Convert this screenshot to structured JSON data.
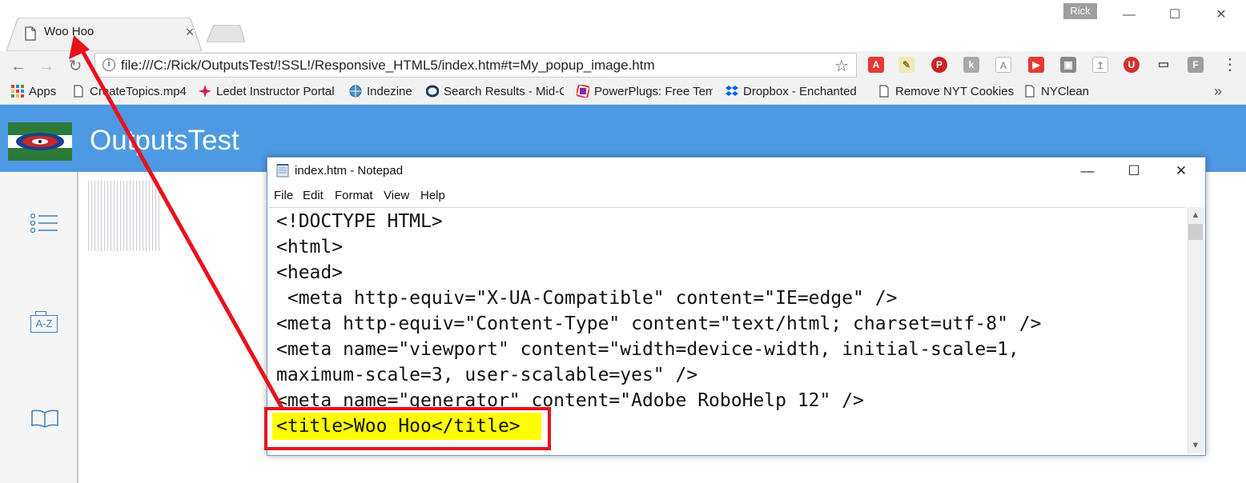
{
  "browser": {
    "tab": {
      "title": "Woo Hoo",
      "close": "×"
    },
    "user": "Rick",
    "window_controls": {
      "minimize": "—",
      "maximize": "☐",
      "close": "✕"
    },
    "nav": {
      "back": "←",
      "forward": "→",
      "reload": "↻"
    },
    "address": {
      "info": "i",
      "url": "file:///C:/Rick/OutputsTest/!SSL!/Responsive_HTML5/index.htm#t=My_popup_image.htm",
      "star": "☆"
    },
    "extensions": [
      "acrobat-icon",
      "notepad-icon",
      "pinterest-icon",
      "kindle-icon",
      "pdf-icon",
      "pushbullet-icon",
      "gray-square-icon",
      "share-icon",
      "ublock-icon",
      "cast-icon",
      "feedly-icon"
    ],
    "menu": "⋮",
    "bookmarks": [
      {
        "label": "Apps",
        "icon": "apps-grid-icon"
      },
      {
        "label": "CreateTopics.mp4",
        "icon": "page-icon"
      },
      {
        "label": "Ledet Instructor Portal",
        "icon": "spark-icon"
      },
      {
        "label": "Indezine",
        "icon": "globe-icon"
      },
      {
        "label": "Search Results - Mid-C",
        "icon": "ring-icon"
      },
      {
        "label": "PowerPlugs: Free Templ",
        "icon": "colorful-icon"
      },
      {
        "label": "Dropbox - Enchanted",
        "icon": "dropbox-icon"
      },
      {
        "label": "Remove NYT Cookies",
        "icon": "page-icon"
      },
      {
        "label": "NYClean",
        "icon": "page-icon"
      }
    ],
    "bookmarks_more": "»"
  },
  "site": {
    "title": "OutputsTest",
    "header_color": "#4e9ae2",
    "sidebar": {
      "index_label": "A-Z"
    }
  },
  "notepad": {
    "title": "index.htm - Notepad",
    "controls": {
      "minimize": "—",
      "maximize": "☐",
      "close": "✕"
    },
    "menu": [
      "File",
      "Edit",
      "Format",
      "View",
      "Help"
    ],
    "lines": [
      "<!DOCTYPE HTML>",
      "<html>",
      "<head>",
      " <meta http-equiv=\"X-UA-Compatible\" content=\"IE=edge\" />",
      "<meta http-equiv=\"Content-Type\" content=\"text/html; charset=utf-8\" />",
      "<meta name=\"viewport\" content=\"width=device-width, initial-scale=1,",
      "maximum-scale=3, user-scalable=yes\" />",
      "<meta name=\"generator\" content=\"Adobe RoboHelp 12\" />",
      "<title>Woo Hoo</title>"
    ]
  },
  "annotation": {
    "color": "#e8121c",
    "highlight_color": "#ffff00"
  }
}
